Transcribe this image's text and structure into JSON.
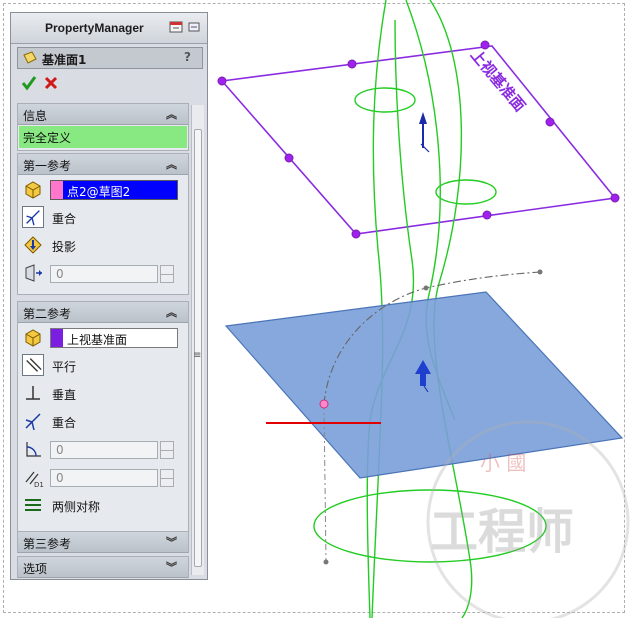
{
  "property_manager": {
    "title": "PropertyManager",
    "feature_name": "基准面1",
    "help": "?"
  },
  "sections": {
    "info": {
      "title": "信息",
      "status": "完全定义",
      "status_color": "#88e882"
    },
    "first_ref": {
      "title": "第一参考",
      "selection": "点2@草图2",
      "selection_swatch_color": "#ff77cc",
      "options": [
        "重合",
        "投影"
      ],
      "value": "0"
    },
    "second_ref": {
      "title": "第二参考",
      "selection": "上视基准面",
      "selection_swatch_color": "#7a1fe0",
      "options": [
        "平行",
        "垂直",
        "重合"
      ],
      "value1": "0",
      "value2": "0",
      "symmetric": "两侧对称"
    },
    "third_ref": {
      "title": "第三参考"
    },
    "options": {
      "title": "选项"
    }
  },
  "viewport": {
    "plane_label": "上视基准面",
    "watermark_small": "小 國",
    "watermark_big": "工程师",
    "plane_color": "#7a9fd8",
    "plane_edge_color": "#8a2be2",
    "curve_color": "#22cc22",
    "axis_color": "#e00000"
  }
}
